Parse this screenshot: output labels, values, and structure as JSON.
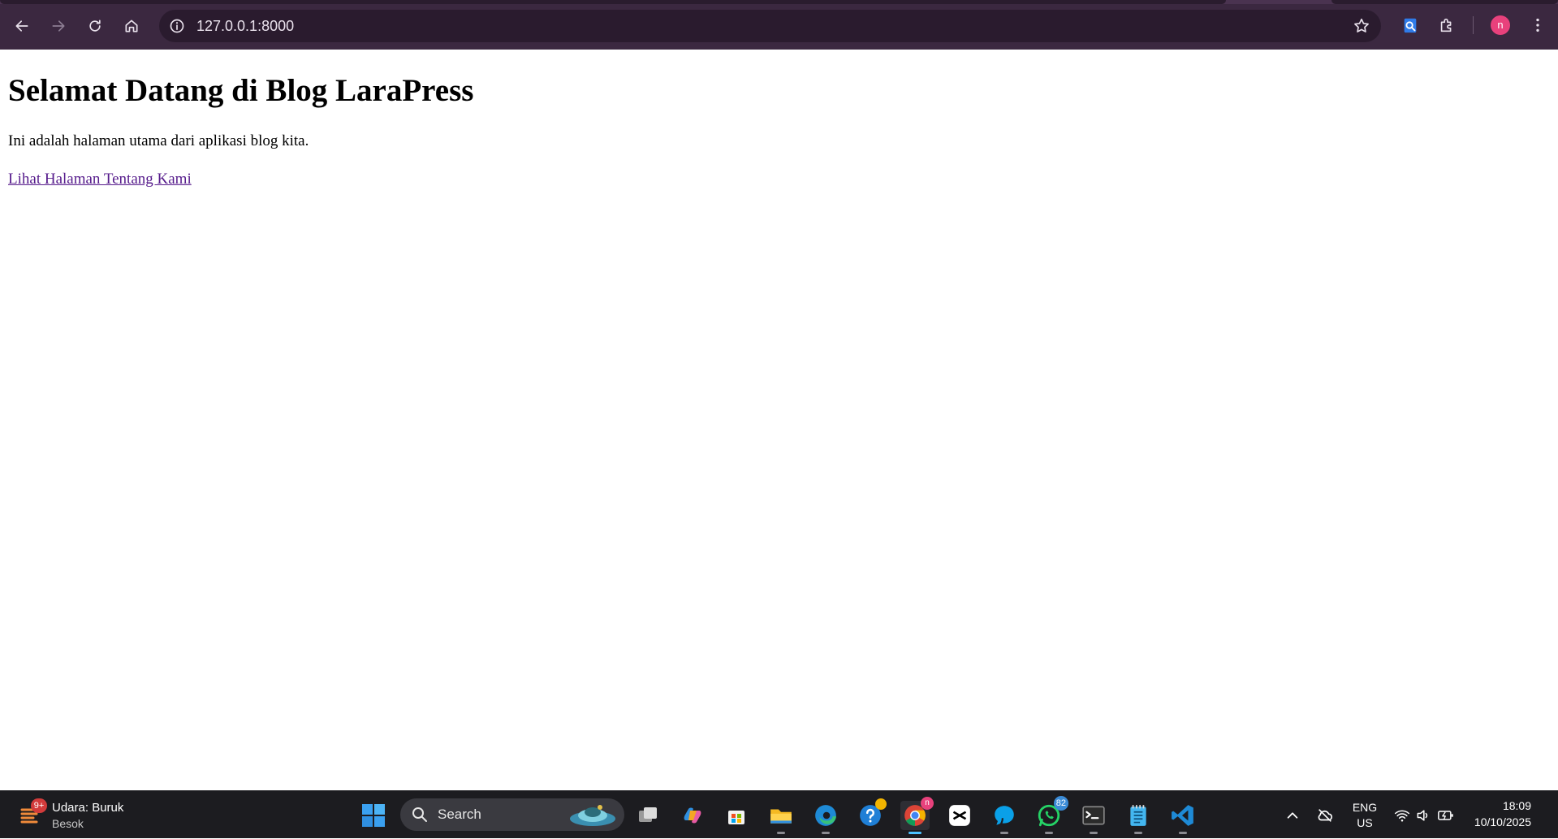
{
  "browser": {
    "url": "127.0.0.1:8000",
    "profile_initial": "n",
    "accent": "#3b2840"
  },
  "page": {
    "heading": "Selamat Datang di Blog LaraPress",
    "paragraph": "Ini adalah halaman utama dari aplikasi blog kita.",
    "link_text": "Lihat Halaman Tentang Kami",
    "link_color": "#551a8b"
  },
  "taskbar": {
    "weather_title": "Udara: Buruk",
    "weather_subtitle": "Besok",
    "weather_badge": "9+",
    "search_label": "Search",
    "whatsapp_count": "82",
    "chrome_profile": "n",
    "apps": [
      "task-view",
      "copilot",
      "microsoft-store",
      "file-explorer",
      "edge",
      "get-help",
      "chrome",
      "capcut",
      "zalo-messenger",
      "whatsapp",
      "terminal",
      "notepad",
      "vscode"
    ],
    "lang_line1": "ENG",
    "lang_line2": "US",
    "time": "18:09",
    "date": "10/10/2025"
  }
}
